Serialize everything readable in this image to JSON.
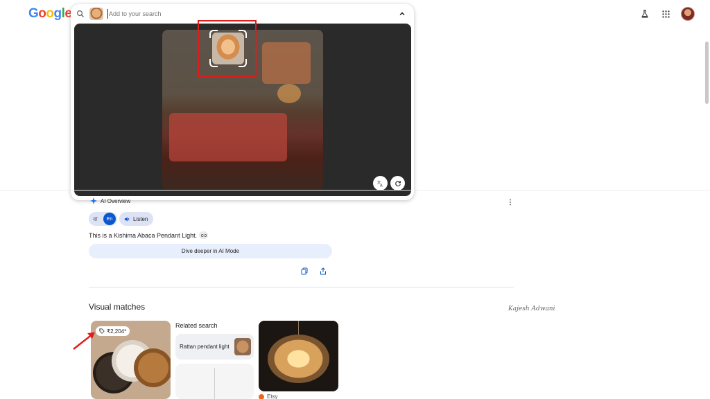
{
  "header": {
    "logo_letters": [
      {
        "ch": "G",
        "color": "#4285F4"
      },
      {
        "ch": "o",
        "color": "#EA4335"
      },
      {
        "ch": "o",
        "color": "#FBBC05"
      },
      {
        "ch": "g",
        "color": "#4285F4"
      },
      {
        "ch": "l",
        "color": "#34A853"
      },
      {
        "ch": "e",
        "color": "#EA4335"
      }
    ],
    "icons": [
      "labs-flask-icon",
      "apps-grid-icon",
      "account-avatar"
    ]
  },
  "search": {
    "placeholder": "Add to your search",
    "value": ""
  },
  "lens": {
    "icons": [
      "translate-icon",
      "refresh-icon"
    ]
  },
  "ai_overview": {
    "label": "AI Overview",
    "lang_other": "বা",
    "lang_active": "En",
    "listen_label": "Listen",
    "answer": "This is a Kishima Abaca Pendant Light.",
    "deeper_label": "Dive deeper in AI Mode"
  },
  "visual_matches": {
    "title": "Visual matches",
    "signature": "Kajesh Adwani",
    "price": "₹2,204*",
    "related_title": "Related search",
    "related_chip_label": "Rattan pendant light",
    "source_name": "Etsy"
  },
  "colors": {
    "accent": "#0b57d0",
    "annotation_red": "#e21b1b",
    "etsy": "#f1641e"
  }
}
